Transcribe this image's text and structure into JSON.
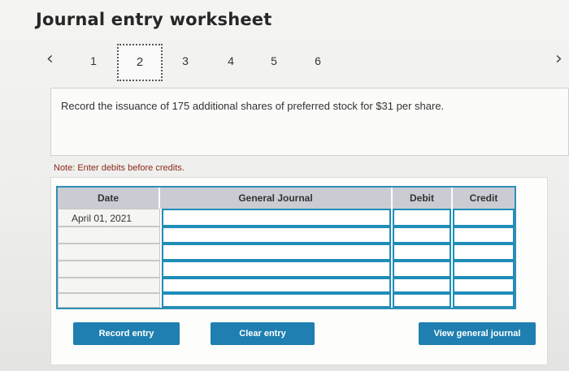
{
  "title": "Journal entry worksheet",
  "pager": {
    "prev_icon": "chevron-left-icon",
    "next_icon": "chevron-right-icon",
    "pages": [
      "1",
      "2",
      "3",
      "4",
      "5",
      "6"
    ],
    "current": "2"
  },
  "instructions": "Record the issuance of 175 additional shares of preferred stock for $31 per share.",
  "note": "Note: Enter debits before credits.",
  "journal": {
    "columns": [
      "Date",
      "General Journal",
      "Debit",
      "Credit"
    ],
    "rows": [
      {
        "date": "April 01, 2021",
        "account": "",
        "debit": "",
        "credit": ""
      },
      {
        "date": "",
        "account": "",
        "debit": "",
        "credit": ""
      },
      {
        "date": "",
        "account": "",
        "debit": "",
        "credit": ""
      },
      {
        "date": "",
        "account": "",
        "debit": "",
        "credit": ""
      },
      {
        "date": "",
        "account": "",
        "debit": "",
        "credit": ""
      },
      {
        "date": "",
        "account": "",
        "debit": "",
        "credit": ""
      }
    ]
  },
  "buttons": {
    "record": "Record entry",
    "clear": "Clear entry",
    "view": "View general journal"
  },
  "colors": {
    "accent": "#1f7fb0",
    "note": "#8b2a1c",
    "header": "#c9ccd2"
  }
}
